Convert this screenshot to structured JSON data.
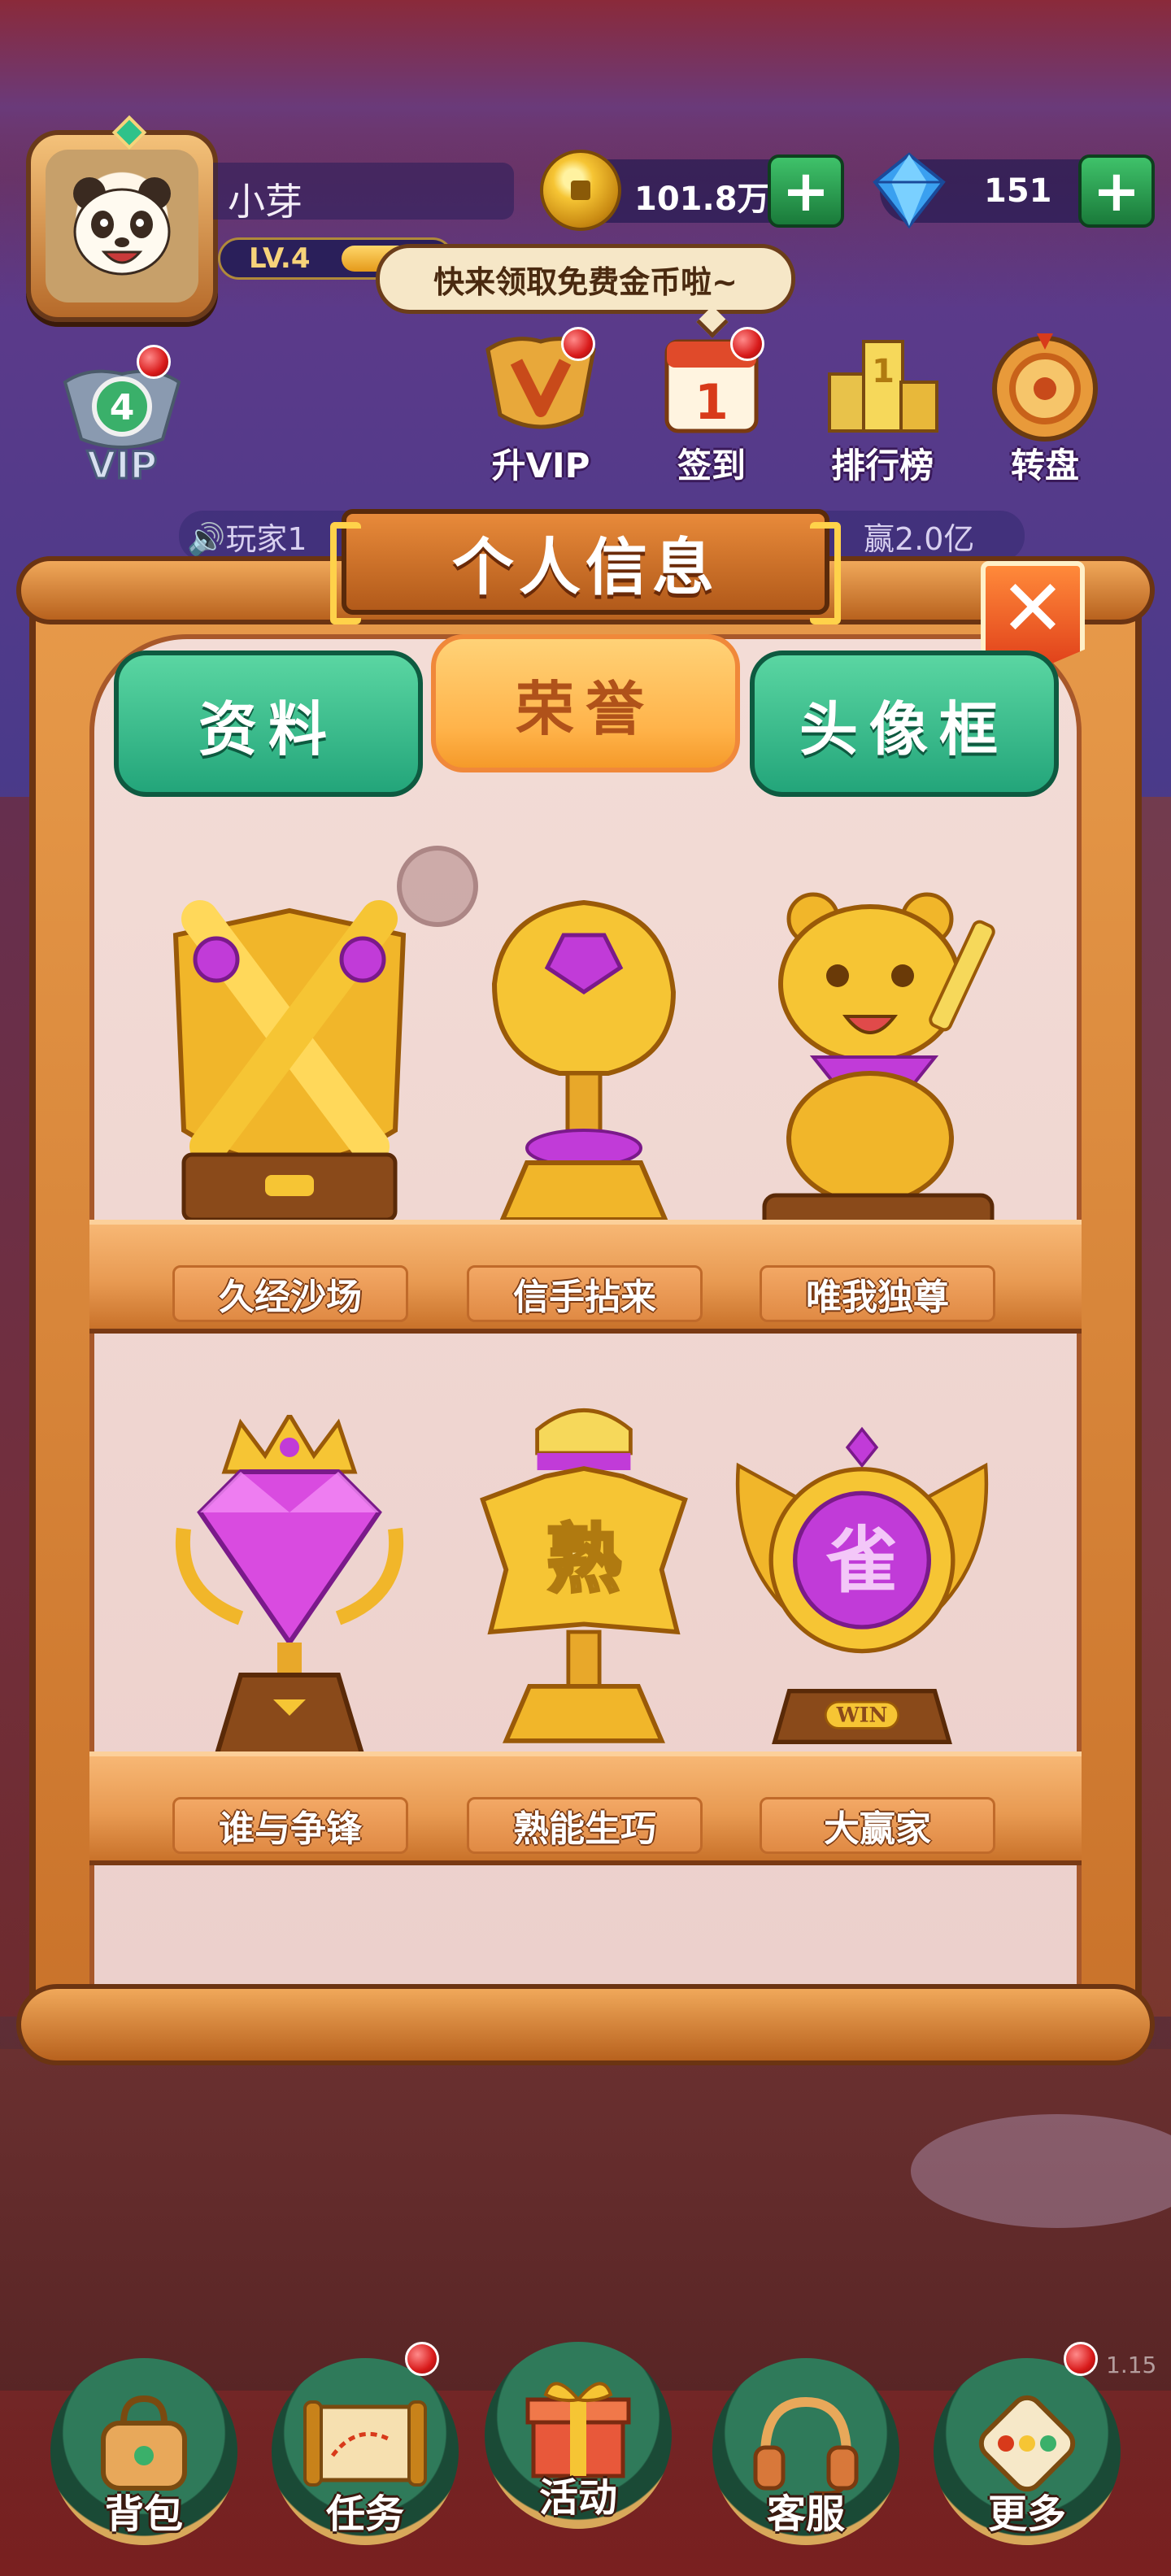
{
  "player": {
    "name": "小芽",
    "level": "LV.4",
    "vip_level": "4",
    "vip_label": "VIP"
  },
  "resources": {
    "coins": "101.8万",
    "gems": "151",
    "add_label": "+"
  },
  "tooltip": "快来领取免费金币啦~",
  "top_icons": [
    {
      "label": "升VIP",
      "icon": "vip-shield-icon"
    },
    {
      "label": "签到",
      "icon": "calendar-icon"
    },
    {
      "label": "排行榜",
      "icon": "leaderboard-icon"
    },
    {
      "label": "转盘",
      "icon": "wheel-icon"
    }
  ],
  "marquee": {
    "left": "🔊玩家1",
    "right": "赢2.0亿"
  },
  "panel": {
    "title": "个人信息",
    "close_label": "✕",
    "tabs": [
      {
        "label": "资料",
        "active": false
      },
      {
        "label": "荣誉",
        "active": true
      },
      {
        "label": "头像框",
        "active": false
      }
    ],
    "honors": [
      {
        "name": "久经沙场",
        "icon": "crossed-swords-trophy-icon"
      },
      {
        "name": "信手拈来",
        "icon": "fist-gem-trophy-icon"
      },
      {
        "name": "唯我独尊",
        "icon": "golden-panda-trophy-icon"
      },
      {
        "name": "谁与争锋",
        "icon": "crowned-diamond-trophy-icon"
      },
      {
        "name": "熟能生巧",
        "icon": "star-shu-trophy-icon"
      },
      {
        "name": "大赢家",
        "icon": "winged-que-medal-icon"
      }
    ],
    "medal_char_shu": "熟",
    "medal_char_que": "雀",
    "win_text": "WIN"
  },
  "bottom_nav": [
    {
      "label": "背包",
      "icon": "bag-icon",
      "badge": false
    },
    {
      "label": "任务",
      "icon": "scroll-map-icon",
      "badge": true
    },
    {
      "label": "活动",
      "icon": "gift-box-icon",
      "badge": false
    },
    {
      "label": "客服",
      "icon": "headset-icon",
      "badge": false
    },
    {
      "label": "更多",
      "icon": "dice-icon",
      "badge": true
    }
  ],
  "version": "1.15",
  "colors": {
    "tab_green": "#23a57a",
    "tab_active": "#ffb34a",
    "panel_wood": "#c9722a",
    "panel_inner": "#f3dcd6",
    "gold": "#f6c534",
    "purple_gem": "#c13bd8"
  }
}
